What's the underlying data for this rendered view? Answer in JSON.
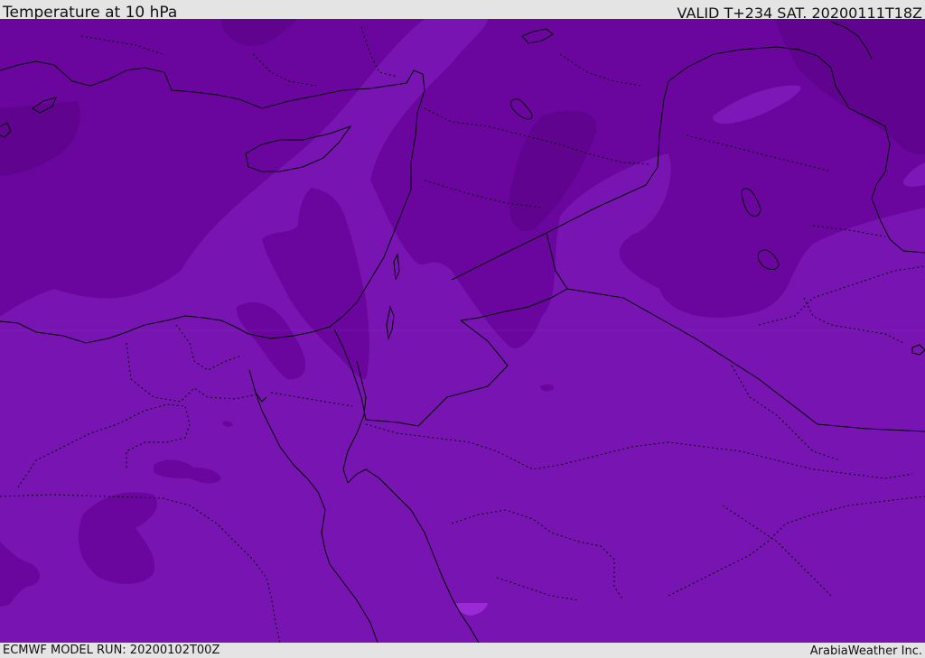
{
  "header": {
    "title": "Temperature at 10 hPa",
    "valid_time": "VALID T+234 SAT. 20200111T18Z"
  },
  "footer": {
    "model_run": "ECMWF MODEL RUN: 20200102T00Z",
    "credit": "ArabiaWeather Inc."
  },
  "map": {
    "colors": {
      "background": "#7815b2",
      "band_dark": "#6a069e",
      "band_darker": "#60048f",
      "band_light": "#7d17b8",
      "highlight": "#9a2bd4",
      "border": "#000000"
    }
  }
}
